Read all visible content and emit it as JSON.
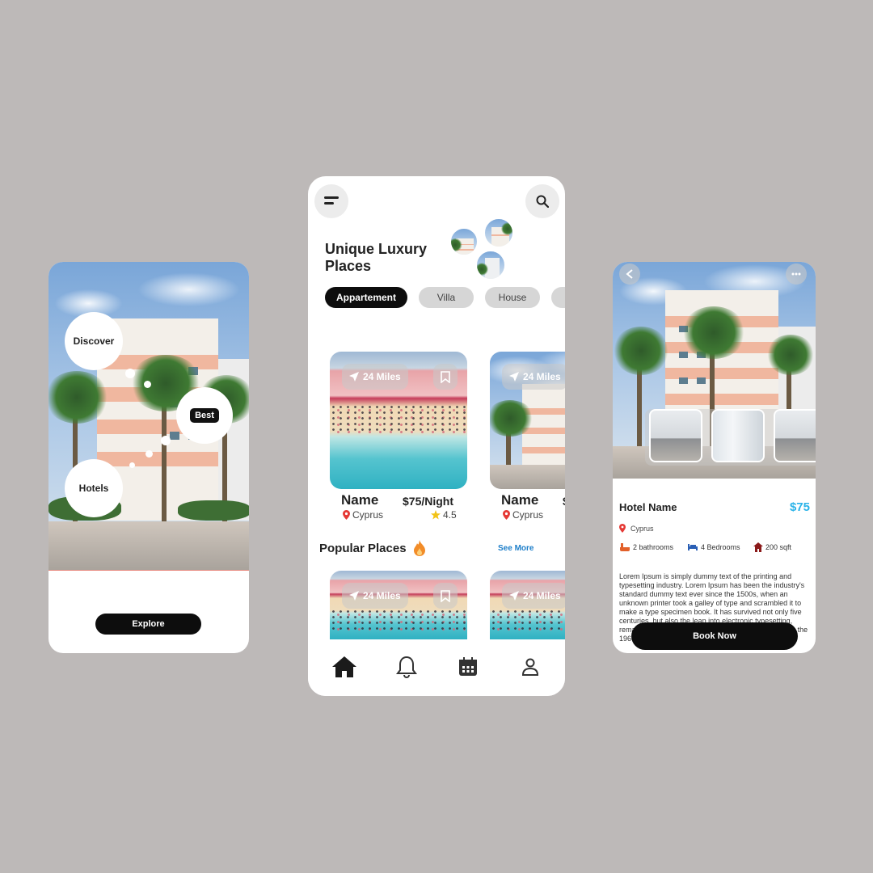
{
  "onboarding": {
    "bubbles": {
      "discover": "Discover",
      "best": "Best",
      "hotels": "Hotels"
    },
    "explore_label": "Explore"
  },
  "home": {
    "title": "Unique Luxury Places",
    "categories": [
      "Appartement",
      "Villa",
      "House",
      ""
    ],
    "active_category": "Appartement",
    "cards": [
      {
        "distance": "24 Miles",
        "name": "Name",
        "price": "$75/Night",
        "location": "Cyprus",
        "rating": "4.5"
      },
      {
        "distance": "24 Miles",
        "name": "Name",
        "price": "$",
        "location": "Cyprus"
      }
    ],
    "popular_title": "Popular Places",
    "see_more": "See More",
    "popular_cards": [
      {
        "distance": "24 Miles"
      },
      {
        "distance": "24 Miles"
      }
    ],
    "nav": [
      "home-icon",
      "bell-icon",
      "calendar-icon",
      "user-icon"
    ]
  },
  "detail": {
    "hotel_name": "Hotel Name",
    "price": "$75",
    "location": "Cyprus",
    "amenities": {
      "bathrooms": "2 bathrooms",
      "bedrooms": "4 Bedrooms",
      "area": "200 sqft"
    },
    "description": "Lorem Ipsum is simply dummy text of the printing and typesetting industry. Lorem Ipsum has been the industry's standard dummy text ever since the 1500s, when an unknown printer took a galley of type and scrambled it to make a type specimen book. It has survived not only five centuries, but also the leap into electronic typesetting, remaining essentially unchanged. It was popularised in the 1960s with the release of Letraset sheets",
    "book_label": "Book Now"
  },
  "colors": {
    "accent": "#2bb3e8",
    "dark": "#0d0d0d",
    "pin": "#e53935",
    "star": "#f2c318",
    "flame": "#f28c28",
    "link": "#1d7ec9"
  }
}
